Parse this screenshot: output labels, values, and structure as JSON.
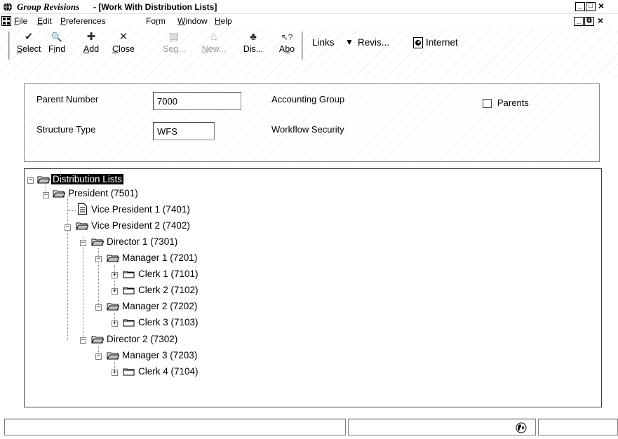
{
  "window": {
    "app_name": "Group Revisions",
    "title": " - [Work With Distribution Lists]",
    "buttons": {
      "minimize": "_",
      "maximize": "□",
      "close": "×"
    }
  },
  "menubar": {
    "items": [
      {
        "underline": "F",
        "rest": "ile"
      },
      {
        "underline": "E",
        "rest": "dit"
      },
      {
        "underline": "P",
        "rest": "references"
      },
      {
        "pre": "Fo",
        "underline": "r",
        "rest": "m"
      },
      {
        "underline": "W",
        "rest": "indow"
      },
      {
        "underline": "H",
        "rest": "elp"
      }
    ],
    "doc_buttons": {
      "minimize": "_",
      "restore": "⧉",
      "close": "×"
    }
  },
  "toolbar": {
    "buttons": [
      {
        "icon": "✔",
        "icon_name": "check-icon",
        "underline": "S",
        "rest": "elect",
        "enabled": true
      },
      {
        "icon": "🔍",
        "icon_name": "find-icon",
        "pre": "F",
        "underline": "i",
        "rest": "nd",
        "enabled": true
      },
      {
        "icon": "✚",
        "icon_name": "add-icon",
        "underline": "A",
        "rest": "dd",
        "enabled": true
      },
      {
        "icon": "✕",
        "icon_name": "close-icon",
        "underline": "C",
        "rest": "lose",
        "enabled": true
      },
      {
        "icon": "▤",
        "icon_name": "sequence-icon",
        "pre": "Se",
        "underline": "q",
        "rest": "...",
        "enabled": false
      },
      {
        "icon": "⌂",
        "icon_name": "new-icon",
        "underline": "N",
        "rest": "ew...",
        "enabled": false
      },
      {
        "icon": "♣",
        "icon_name": "display-icon",
        "pre": "Dis...",
        "underline": "",
        "rest": "",
        "enabled": true
      },
      {
        "icon": "↖?",
        "icon_name": "about-icon",
        "pre": "A",
        "underline": "b",
        "rest": "o",
        "enabled": true
      }
    ],
    "links_label": "Links",
    "revis_label": "Revis...",
    "internet_label": "Internet"
  },
  "form": {
    "parent_number_label": "Parent Number",
    "parent_number_value": "7000",
    "parent_number_desc": "Accounting Group",
    "structure_type_label": "Structure Type",
    "structure_type_value": "WFS",
    "structure_type_desc": "Workflow Security",
    "parents_label": "Parents",
    "parents_checked": false
  },
  "tree": {
    "nodes": [
      {
        "label": "Distribution Lists",
        "icon": "folder-open",
        "expanded": true,
        "selected": true
      },
      {
        "label": "President (7501)",
        "icon": "folder-open",
        "expanded": true
      },
      {
        "label": "Vice President 1 (7401)",
        "icon": "document"
      },
      {
        "label": "Vice President 2 (7402)",
        "icon": "folder-open",
        "expanded": true
      },
      {
        "label": "Director 1 (7301)",
        "icon": "folder-open",
        "expanded": true
      },
      {
        "label": "Manager 1 (7201)",
        "icon": "folder-open",
        "expanded": true
      },
      {
        "label": "Clerk 1 (7101)",
        "icon": "folder-closed",
        "expanded": false
      },
      {
        "label": "Clerk 2 (7102)",
        "icon": "folder-closed",
        "expanded": false
      },
      {
        "label": "Manager 2 (7202)",
        "icon": "folder-open",
        "expanded": true
      },
      {
        "label": "Clerk 3 (7103)",
        "icon": "folder-closed",
        "expanded": false
      },
      {
        "label": "Director 2 (7302)",
        "icon": "folder-open",
        "expanded": true
      },
      {
        "label": "Manager 3 (7203)",
        "icon": "folder-open",
        "expanded": true
      },
      {
        "label": "Clerk 4 (7104)",
        "icon": "folder-closed",
        "expanded": false
      }
    ]
  },
  "statusbar": {
    "globe_icon": "globe-icon"
  }
}
